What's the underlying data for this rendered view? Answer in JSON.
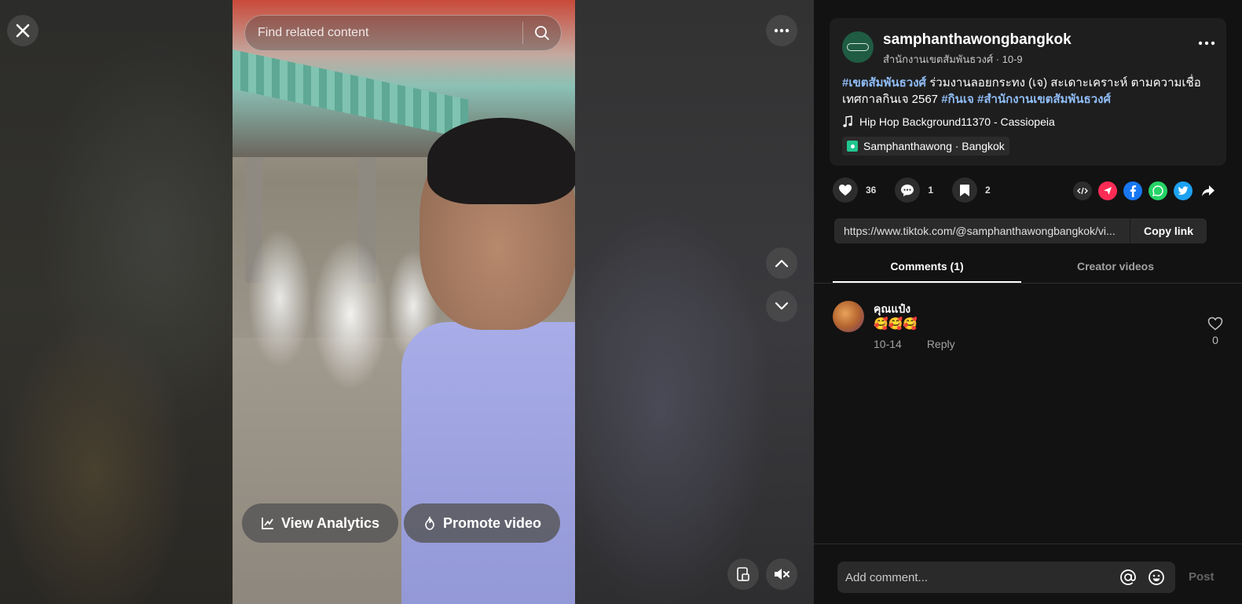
{
  "search": {
    "placeholder": "Find related content"
  },
  "video": {
    "analytics_label": "View Analytics",
    "promote_label": "Promote video"
  },
  "post": {
    "username": "samphanthawongbangkok",
    "subline": "สำนักงานเขตสัมพันธวงศ์ · 10-9",
    "caption_tag1": "#เขตสัมพันธวงศ์",
    "caption_text": " ร่วมงานลอยกระทง (เจ) สะเดาะเคราะห์ ตามความเชื่อเทศกาลกินเจ 2567 ",
    "caption_tag2": "#กินเจ",
    "caption_tag3": " #สำนักงานเขตสัมพันธวงศ์",
    "music": "Hip Hop Background11370 - Cassiopeia",
    "location": "Samphanthawong · Bangkok"
  },
  "stats": {
    "likes": "36",
    "comments": "1",
    "saves": "2"
  },
  "link": {
    "url": "https://www.tiktok.com/@samphanthawongbangkok/vi...",
    "copy_label": "Copy link"
  },
  "tabs": [
    {
      "label": "Comments (1)"
    },
    {
      "label": "Creator videos"
    }
  ],
  "comments": [
    {
      "name": "คุณแป๋ง",
      "text": "🥰🥰🥰",
      "date": "10-14",
      "reply": "Reply",
      "likes": "0"
    }
  ],
  "composer": {
    "placeholder": "Add comment...",
    "post_label": "Post"
  },
  "colors": {
    "hashtag": "#8fbcf5",
    "panel_bg": "#121212",
    "card_bg": "#1e1e1e",
    "share_red": "#fe2c55",
    "facebook": "#1877f2",
    "whatsapp": "#25d366",
    "twitter": "#1da1f2"
  }
}
